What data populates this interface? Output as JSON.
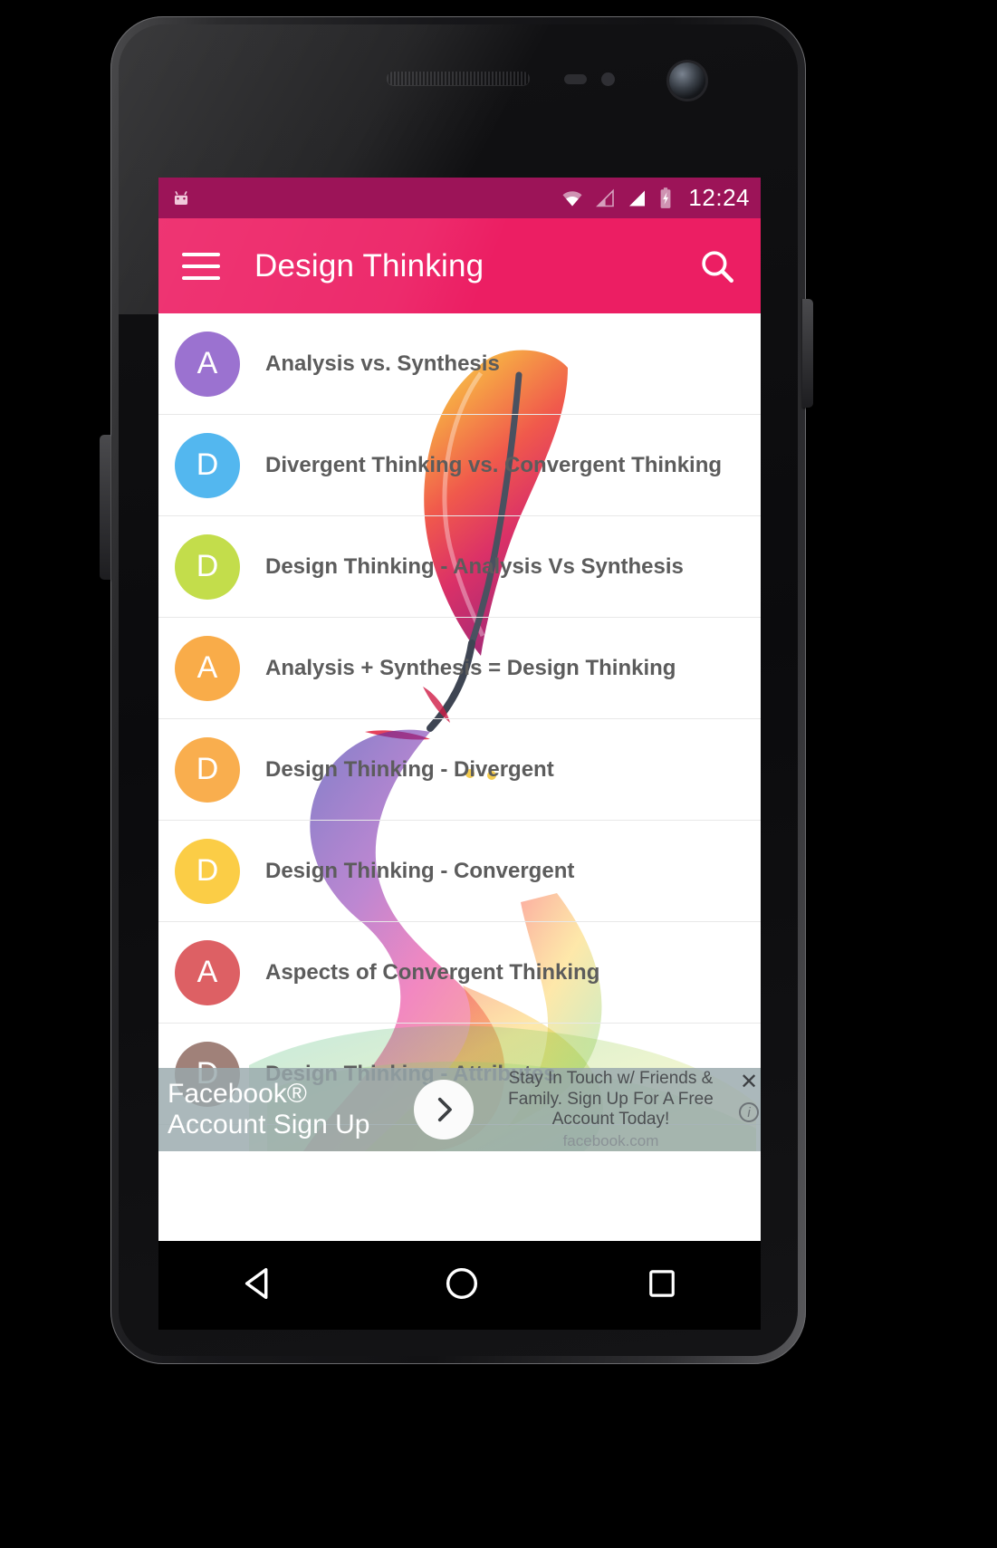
{
  "device": {
    "name": "android-phone",
    "earpiece": "earpiece-speaker",
    "camera": "front-camera"
  },
  "status_bar": {
    "time": "12:24",
    "background": "#9c1458",
    "icons": [
      "android-robot-icon",
      "wifi-icon",
      "signal-empty-icon",
      "signal-full-icon",
      "battery-charging-icon"
    ]
  },
  "app_bar": {
    "title": "Design Thinking",
    "background": "#ec1e63",
    "menu_icon": "hamburger-menu-icon",
    "search_icon": "search-icon"
  },
  "list": {
    "items": [
      {
        "initial": "A",
        "label": "Analysis vs. Synthesis",
        "color": "#9b72d0"
      },
      {
        "initial": "D",
        "label": "Divergent Thinking vs. Convergent Thinking",
        "color": "#53b7ef"
      },
      {
        "initial": "D",
        "label": "Design Thinking - Analysis Vs Synthesis",
        "color": "#c3dd4b"
      },
      {
        "initial": "A",
        "label": "Analysis + Synthesis = Design Thinking",
        "color": "#f9ac49"
      },
      {
        "initial": "D",
        "label": "Design Thinking - Divergent",
        "color": "#f9ae4e"
      },
      {
        "initial": "D",
        "label": "Design Thinking - Convergent",
        "color": "#fbcd46"
      },
      {
        "initial": "A",
        "label": "Aspects of Convergent Thinking",
        "color": "#dd6064"
      },
      {
        "initial": "D",
        "label": "Design Thinking - Attributes",
        "color": "#a08179"
      }
    ]
  },
  "ad": {
    "headline": "Facebook® Account Sign Up",
    "cta_icon": "chevron-right-icon",
    "body": "Stay In Touch w/ Friends & Family. Sign Up For A Free Account Today!",
    "url": "facebook.com",
    "close_icon": "close-icon",
    "info_icon": "ad-info-icon"
  },
  "nav_bar": {
    "back": "back-triangle-icon",
    "home": "home-circle-icon",
    "recents": "recents-square-icon"
  }
}
